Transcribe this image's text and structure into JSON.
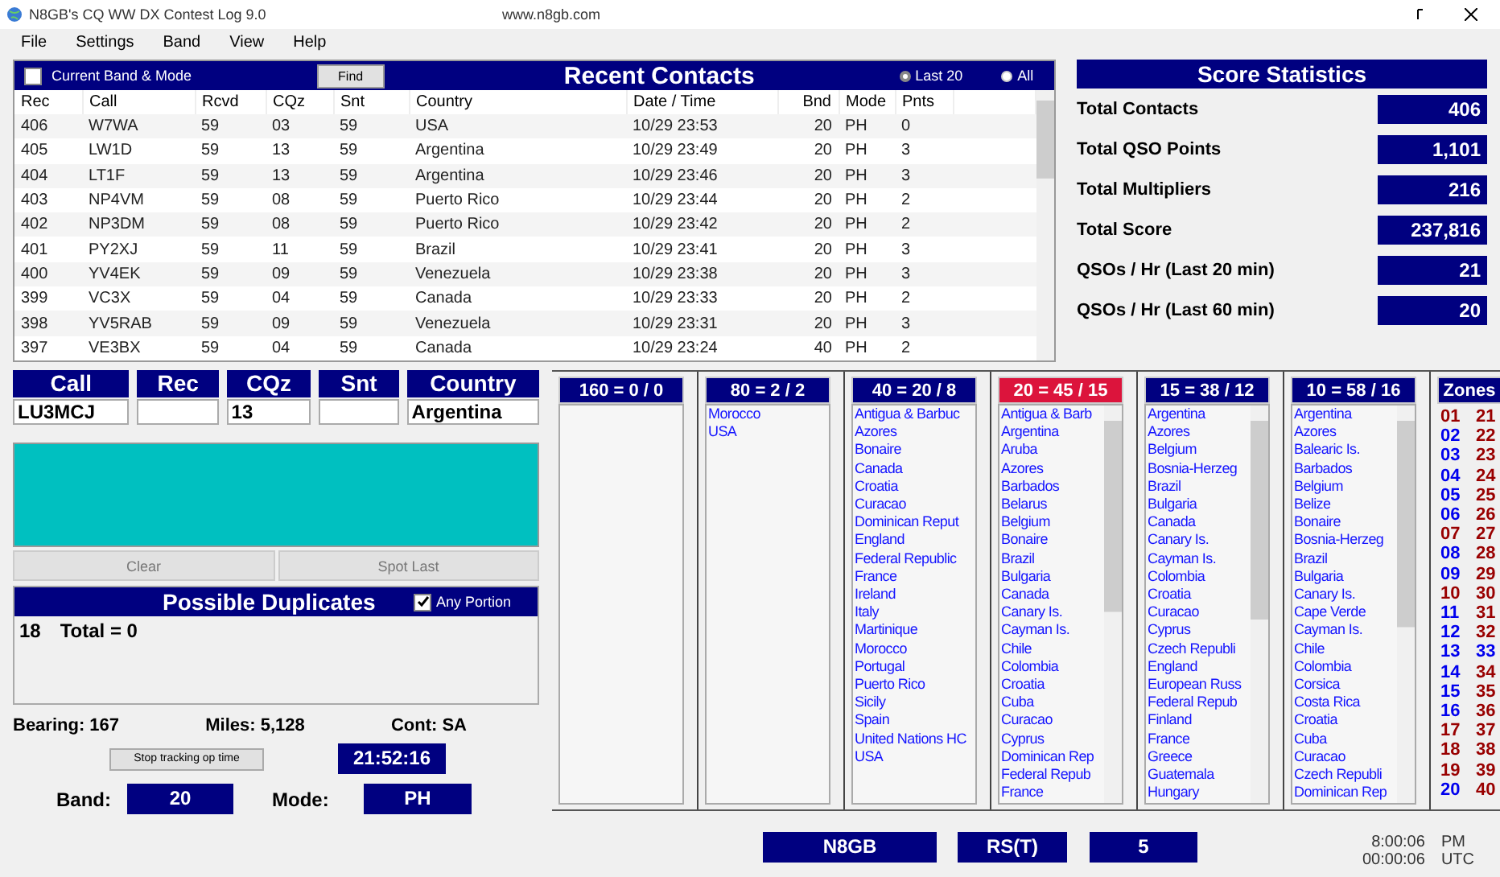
{
  "window": {
    "title": "N8GB's CQ WW DX Contest Log 9.0",
    "url": "www.n8gb.com"
  },
  "menu": [
    "File",
    "Settings",
    "Band",
    "View",
    "Help"
  ],
  "recent": {
    "title": "Recent Contacts",
    "filter_checkbox": {
      "label": "Current Band & Mode",
      "checked": false
    },
    "find_button": "Find",
    "radios": [
      {
        "label": "Last 20",
        "selected": true
      },
      {
        "label": "All",
        "selected": false
      }
    ],
    "columns": [
      "Rec",
      "Call",
      "Rcvd",
      "CQz",
      "Snt",
      "Country",
      "Date  /  Time",
      "Bnd",
      "Mode",
      "Pnts"
    ],
    "rows": [
      [
        "406",
        "W7WA",
        "59",
        "03",
        "59",
        "USA",
        "10/29  23:53",
        "20",
        "PH",
        "0"
      ],
      [
        "405",
        "LW1D",
        "59",
        "13",
        "59",
        "Argentina",
        "10/29  23:49",
        "20",
        "PH",
        "3"
      ],
      [
        "404",
        "LT1F",
        "59",
        "13",
        "59",
        "Argentina",
        "10/29  23:46",
        "20",
        "PH",
        "3"
      ],
      [
        "403",
        "NP4VM",
        "59",
        "08",
        "59",
        "Puerto Rico",
        "10/29  23:44",
        "20",
        "PH",
        "2"
      ],
      [
        "402",
        "NP3DM",
        "59",
        "08",
        "59",
        "Puerto Rico",
        "10/29  23:42",
        "20",
        "PH",
        "2"
      ],
      [
        "401",
        "PY2XJ",
        "59",
        "11",
        "59",
        "Brazil",
        "10/29  23:41",
        "20",
        "PH",
        "3"
      ],
      [
        "400",
        "YV4EK",
        "59",
        "09",
        "59",
        "Venezuela",
        "10/29  23:38",
        "20",
        "PH",
        "3"
      ],
      [
        "399",
        "VC3X",
        "59",
        "04",
        "59",
        "Canada",
        "10/29  23:33",
        "20",
        "PH",
        "2"
      ],
      [
        "398",
        "YV5RAB",
        "59",
        "09",
        "59",
        "Venezuela",
        "10/29  23:31",
        "20",
        "PH",
        "3"
      ],
      [
        "397",
        "VE3BX",
        "59",
        "04",
        "59",
        "Canada",
        "10/29  23:24",
        "40",
        "PH",
        "2"
      ]
    ]
  },
  "score": {
    "title": "Score Statistics",
    "stats": [
      {
        "label": "Total Contacts",
        "value": "406"
      },
      {
        "label": "Total QSO Points",
        "value": "1,101"
      },
      {
        "label": "Total Multipliers",
        "value": "216"
      },
      {
        "label": "Total Score",
        "value": "237,816"
      },
      {
        "label": "QSOs / Hr (Last 20 min)",
        "value": "21"
      },
      {
        "label": "QSOs / Hr (Last 60 min)",
        "value": "20"
      }
    ]
  },
  "entry": {
    "fields": [
      {
        "label": "Call",
        "value": "LU3MCJ"
      },
      {
        "label": "Rec"
      },
      {
        "label": "CQz",
        "value": "13"
      },
      {
        "label": "Snt"
      },
      {
        "label": "Country",
        "value": "Argentina"
      }
    ],
    "buttons": [
      {
        "label": "Clear",
        "disabled": true
      },
      {
        "label": "Spot Last",
        "disabled": true
      }
    ]
  },
  "duplicates": {
    "title": "Possible Duplicates",
    "option": {
      "label": "Any Portion",
      "checked": true
    },
    "lines": [
      {
        "count": "18",
        "text": "Total = 0"
      }
    ]
  },
  "info": {
    "bearing": "Bearing: 167",
    "miles": "Miles: 5,128",
    "cont": "Cont: SA",
    "stop_button": "Stop tracking op time",
    "op_time": "21:52:16",
    "band_label": "Band:",
    "band": "20",
    "mode_label": "Mode:",
    "mode": "PH"
  },
  "bands": [
    {
      "title": "160 = 0 / 0",
      "selected": false
    },
    {
      "title": "80 = 2 / 2",
      "selected": false,
      "countries": [
        "Morocco",
        "USA"
      ]
    },
    {
      "title": "40 = 20 / 8",
      "selected": false,
      "countries": [
        "Antigua & Barbuc",
        "Azores",
        "Bonaire",
        "Canada",
        "Croatia",
        "Curacao",
        "Dominican Reput",
        "England",
        "Federal Republic",
        "France",
        "Ireland",
        "Italy",
        "Martinique",
        "Morocco",
        "Portugal",
        "Puerto Rico",
        "Sicily",
        "Spain",
        "United Nations HC",
        "USA"
      ]
    },
    {
      "title": "20 = 45 / 15",
      "selected": true,
      "countries": [
        "Antigua & Barb",
        "Argentina",
        "Aruba",
        "Azores",
        "Barbados",
        "Belarus",
        "Belgium",
        "Bonaire",
        "Brazil",
        "Bulgaria",
        "Canada",
        "Canary Is.",
        "Cayman Is.",
        "Chile",
        "Colombia",
        "Croatia",
        "Cuba",
        "Curacao",
        "Cyprus",
        "Dominican Rep",
        "Federal Repub",
        "France"
      ]
    },
    {
      "title": "15 = 38 / 12",
      "selected": false,
      "countries": [
        "Argentina",
        "Azores",
        "Belgium",
        "Bosnia-Herzeg",
        "Brazil",
        "Bulgaria",
        "Canada",
        "Canary Is.",
        "Cayman Is.",
        "Colombia",
        "Croatia",
        "Curacao",
        "Cyprus",
        "Czech Republi",
        "England",
        "European Russ",
        "Federal Repub",
        "Finland",
        "France",
        "Greece",
        "Guatemala",
        "Hungary"
      ]
    },
    {
      "title": "10 = 58 / 16",
      "selected": false,
      "countries": [
        "Argentina",
        "Azores",
        "Balearic Is.",
        "Barbados",
        "Belgium",
        "Belize",
        "Bonaire",
        "Bosnia-Herzeg",
        "Brazil",
        "Bulgaria",
        "Canary Is.",
        "Cape Verde",
        "Cayman Is.",
        "Chile",
        "Colombia",
        "Corsica",
        "Costa Rica",
        "Croatia",
        "Cuba",
        "Curacao",
        "Czech Republi",
        "Dominican Rep"
      ]
    }
  ],
  "zones": {
    "title": "Zones",
    "items": [
      {
        "label": "01",
        "color": "#990000"
      },
      {
        "label": "21",
        "color": "#990000"
      },
      {
        "label": "02",
        "color": "#0000ee"
      },
      {
        "label": "22",
        "color": "#990000"
      },
      {
        "label": "03",
        "color": "#0000ee"
      },
      {
        "label": "23",
        "color": "#990000"
      },
      {
        "label": "04",
        "color": "#0000ee"
      },
      {
        "label": "24",
        "color": "#990000"
      },
      {
        "label": "05",
        "color": "#0000ee"
      },
      {
        "label": "25",
        "color": "#990000"
      },
      {
        "label": "06",
        "color": "#0000ee"
      },
      {
        "label": "26",
        "color": "#990000"
      },
      {
        "label": "07",
        "color": "#990000"
      },
      {
        "label": "27",
        "color": "#990000"
      },
      {
        "label": "08",
        "color": "#0000ee"
      },
      {
        "label": "28",
        "color": "#990000"
      },
      {
        "label": "09",
        "color": "#0000ee"
      },
      {
        "label": "29",
        "color": "#990000"
      },
      {
        "label": "10",
        "color": "#990000"
      },
      {
        "label": "30",
        "color": "#990000"
      },
      {
        "label": "11",
        "color": "#0000ee"
      },
      {
        "label": "31",
        "color": "#990000"
      },
      {
        "label": "12",
        "color": "#0000ee"
      },
      {
        "label": "32",
        "color": "#990000"
      },
      {
        "label": "13",
        "color": "#0000ee"
      },
      {
        "label": "33",
        "color": "#0000ee"
      },
      {
        "label": "14",
        "color": "#0000ee"
      },
      {
        "label": "34",
        "color": "#990000"
      },
      {
        "label": "15",
        "color": "#0000ee"
      },
      {
        "label": "35",
        "color": "#990000"
      },
      {
        "label": "16",
        "color": "#0000ee"
      },
      {
        "label": "36",
        "color": "#990000"
      },
      {
        "label": "17",
        "color": "#990000"
      },
      {
        "label": "37",
        "color": "#990000"
      },
      {
        "label": "18",
        "color": "#990000"
      },
      {
        "label": "38",
        "color": "#990000"
      },
      {
        "label": "19",
        "color": "#990000"
      },
      {
        "label": "39",
        "color": "#990000"
      },
      {
        "label": "20",
        "color": "#0000ee"
      },
      {
        "label": "40",
        "color": "#990000"
      }
    ]
  },
  "status": {
    "operator": "N8GB",
    "report": "RS(T)",
    "count": "5",
    "local_time": "8:00:06",
    "local_label": "PM",
    "utc_time": "00:00:06",
    "utc_label": "UTC"
  }
}
